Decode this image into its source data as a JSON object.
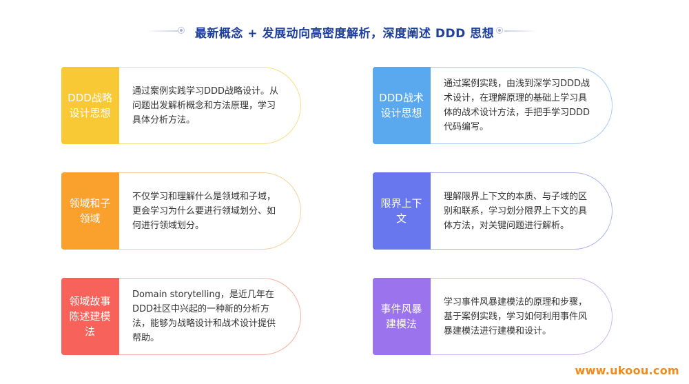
{
  "header": {
    "title": "最新概念 + 发展动向高密度解析，深度阐述 DDD 思想"
  },
  "cards": [
    {
      "badge": "DDD战略设计思想",
      "text": "通过案例实践学习DDD战略设计。从问题出发解析概念和方法原理，学习具体分析方法。",
      "color": "#f9c935"
    },
    {
      "badge": "DDD战术设计思想",
      "text": "通过案例实践，由浅到深学习DDD战术设计，在理解原理的基础上学习具体的战术设计方法，手把手学习DDD代码编写。",
      "color": "#5aa8ee"
    },
    {
      "badge": "领域和子领域",
      "text": "不仅学习和理解什么是领域和子域，更会学习为什么要进行领域划分、如何进行领域划分。",
      "color": "#f9a12c"
    },
    {
      "badge": "限界上下文",
      "text": "理解限界上下文的本质、与子域的区别和联系，学习划分限界上下文的具体方法，对关键问题进行解析。",
      "color": "#6877ee"
    },
    {
      "badge": "领域故事陈述建模法",
      "text": "Domain storytelling，是近几年在DDD社区中兴起的一种新的分析方法，能够为战略设计和战术设计提供帮助。",
      "color": "#f7635a"
    },
    {
      "badge": "事件风暴建模法",
      "text": "学习事件风暴建模法的原理和步骤，基于案例实践，学习如何利用事件风暴建模法进行建模和设计。",
      "color": "#9b73ec"
    }
  ],
  "watermark": "www.ukoou.com"
}
